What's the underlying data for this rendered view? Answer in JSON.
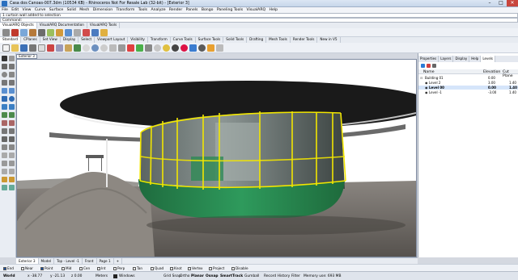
{
  "window": {
    "title": "Casa dos Canoas-007.3dm (10534 KB) - Rhinoceros Not For Resale Lab (32-bit) - [Exterior 3]",
    "minimize": "–",
    "maximize": "□",
    "close": "✕"
  },
  "menu": [
    "File",
    "Edit",
    "View",
    "Curve",
    "Surface",
    "Solid",
    "Mesh",
    "Dimension",
    "Transform",
    "Tools",
    "Analyze",
    "Render",
    "Panels",
    "Bongo",
    "Paneling Tools",
    "VisualARQ",
    "Help"
  ],
  "command": {
    "history": "1 curtain wall added to selection",
    "prompt": "Command:"
  },
  "toolbar_tabs_1": [
    "VisualARQ Objects",
    "VisualARQ Documentation",
    "VisualARQ Tools"
  ],
  "toolbar_tabs_2": [
    "Standard",
    "CPlanes",
    "Set View",
    "Display",
    "Select",
    "Viewport Layout",
    "Visibility",
    "Transform",
    "Curve Tools",
    "Surface Tools",
    "Solid Tools",
    "Drafting",
    "Mesh Tools",
    "Render Tools",
    "New in V5"
  ],
  "viewport": {
    "tab_label": "Exterior 3",
    "colors": {
      "sky": "#ffffff",
      "ground": "#6e6a66",
      "roof": "#1c1c1c",
      "base": "#2e8a55",
      "glass": "#7f8a88",
      "mullion": "#f2e600"
    }
  },
  "panel": {
    "tabs": [
      "Properties",
      "Layers",
      "Display",
      "Help",
      "Levels"
    ],
    "active_tab": "Levels",
    "columns": {
      "name": "Name",
      "elevation": "Elevation",
      "cut_plane": "Cut Plane"
    },
    "rows": [
      {
        "name": "Building 01",
        "elevation": "0.00",
        "cut_plane": ""
      },
      {
        "name": "Level 2",
        "elevation": "3.00",
        "cut_plane": "1.40"
      },
      {
        "name": "Level 00",
        "elevation": "0.00",
        "cut_plane": "1.40"
      },
      {
        "name": "Level -1",
        "elevation": "-3.00",
        "cut_plane": "1.40"
      }
    ]
  },
  "viewport_tabs": [
    "Exterior 3",
    "Model",
    "Top - Level -1",
    "Front",
    "Page 1"
  ],
  "viewport_tab_add": "+",
  "osnaps": [
    {
      "label": "End",
      "on": true
    },
    {
      "label": "Near",
      "on": false
    },
    {
      "label": "Point",
      "on": true
    },
    {
      "label": "Mid",
      "on": false
    },
    {
      "label": "Cen",
      "on": false
    },
    {
      "label": "Int",
      "on": false
    },
    {
      "label": "Perp",
      "on": false
    },
    {
      "label": "Tan",
      "on": false
    },
    {
      "label": "Quad",
      "on": false
    },
    {
      "label": "Knot",
      "on": false
    },
    {
      "label": "Vertex",
      "on": false
    },
    {
      "label": "Project",
      "on": false
    },
    {
      "label": "Disable",
      "on": false
    }
  ],
  "statusbar": {
    "cplane": "World",
    "x": "x -38.77",
    "y": "y -21.13",
    "z": "z 0.00",
    "units": "Meters",
    "layer": "Windows",
    "grid_snap": "Grid Snap",
    "ortho": "Ortho",
    "planar": "Planar",
    "osnap": "Osnap",
    "smarttrack": "SmartTrack",
    "gumball": "Gumball",
    "record_history": "Record History",
    "filter": "Filter",
    "memory": "Memory use: 693 MB"
  }
}
